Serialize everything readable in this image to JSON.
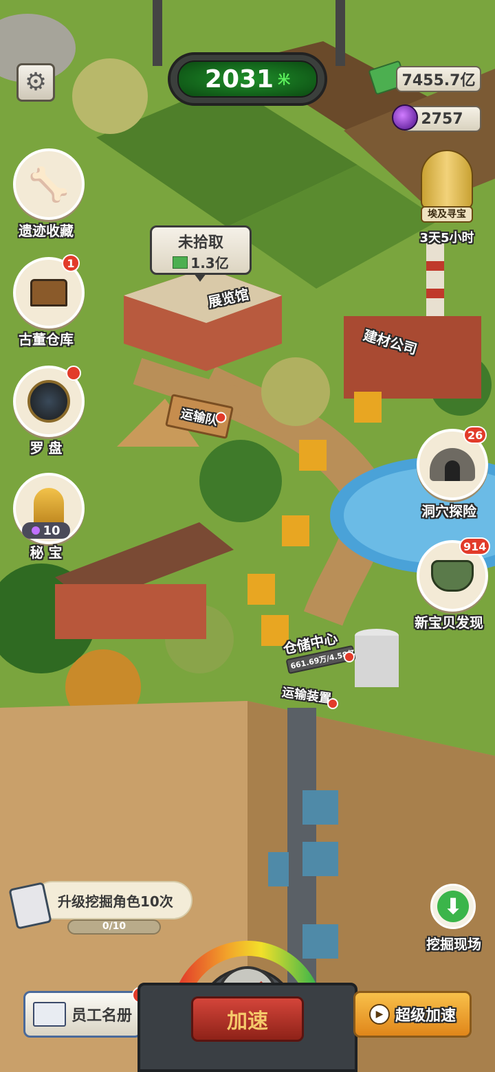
{
  "hud": {
    "score": "2031",
    "score_unit": "米",
    "cash": "7455.7亿",
    "gems": "2757"
  },
  "egypt": {
    "label": "埃及寻宝",
    "timer": "3天5小时"
  },
  "left_menu": [
    {
      "label": "遗迹收藏",
      "badge": ""
    },
    {
      "label": "古董仓库",
      "badge": "1"
    },
    {
      "label": "罗 盘",
      "badge": ""
    },
    {
      "label": "秘 宝",
      "cost": "10"
    }
  ],
  "right_menu": [
    {
      "label": "洞穴探险",
      "badge": "26"
    },
    {
      "label": "新宝贝发现",
      "badge": "914"
    }
  ],
  "map": {
    "uncollected_title": "未拾取",
    "uncollected_value": "1.3亿",
    "museum": "展览馆",
    "building_company": "建材公司",
    "transport_team": "运输队",
    "storage_center": "仓储中心",
    "storage_value": "661.69万/4.58亿",
    "transport_device": "运输装置"
  },
  "task": {
    "title": "升级挖掘角色10次",
    "progress_text": "0/10",
    "progress": 0
  },
  "bottom": {
    "dig_site": "挖掘现场",
    "staff_roster": "员工名册",
    "speed_up": "加速",
    "super_speed": "超级加速"
  },
  "colors": {
    "accent_green": "#23c23a",
    "badge_red": "#e23b2a",
    "speed_red": "#b8322a",
    "super_orange": "#f2a22a"
  }
}
